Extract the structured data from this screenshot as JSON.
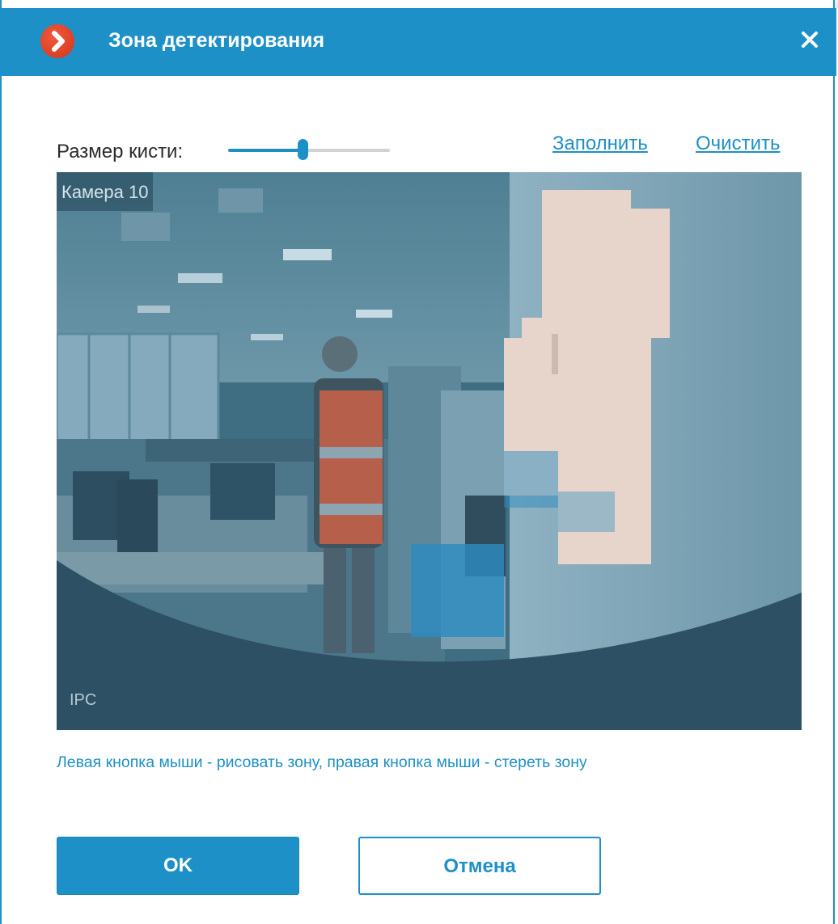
{
  "dialog": {
    "title": "Зона детектирования",
    "logo_icon": "app-logo-chevron-icon",
    "close_icon": "close-icon"
  },
  "toolbar": {
    "brush_size_label": "Размер кисти:",
    "brush_size_level": 0.46,
    "fill_link": "Заполнить",
    "clear_link": "Очистить"
  },
  "video": {
    "camera_name": "Камера 10",
    "stream_tag": "IPC"
  },
  "hint": "Левая кнопка мыши - рисовать зону, правая кнопка мыши - стереть зону",
  "buttons": {
    "ok": "OK",
    "cancel": "Отмена"
  },
  "colors": {
    "accent": "#1e90c8",
    "zone_overlay": "#2d8bbf"
  }
}
